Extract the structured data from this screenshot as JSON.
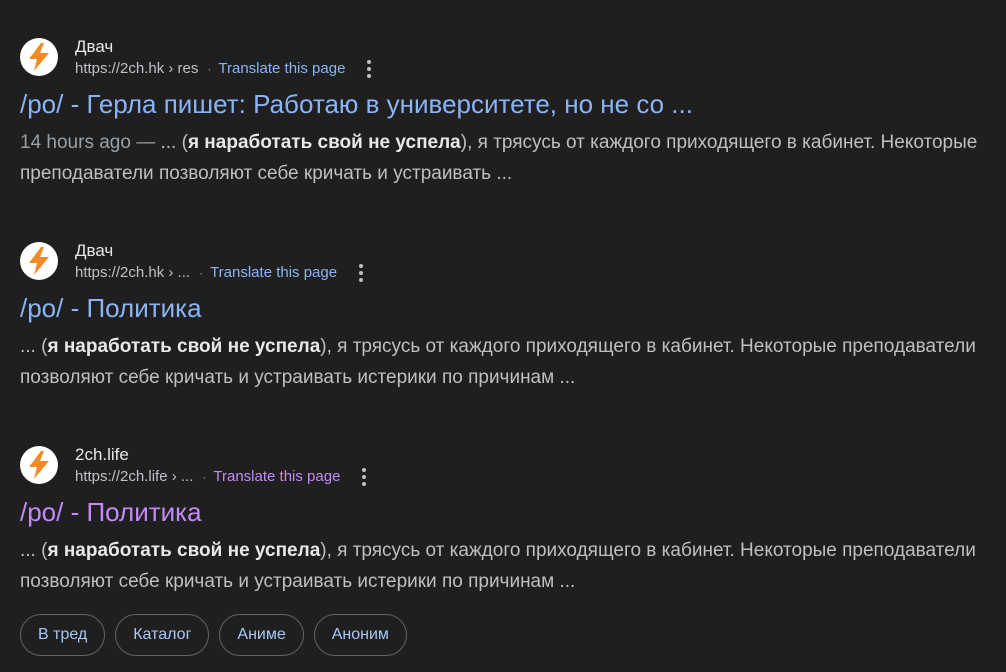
{
  "results": [
    {
      "site_name": "Двач",
      "url": "https://2ch.hk › res",
      "translate": "Translate this page",
      "title": "/po/ - Герла пишет: Работаю в университете, но не со ...",
      "date": "14 hours ago —",
      "pre": " ... (",
      "bold": "я наработать свой не успела",
      "post": "), я трясусь от каждого приходящего в кабинет. Некоторые преподаватели позволяют себе кричать и устраивать ..."
    },
    {
      "site_name": "Двач",
      "url": "https://2ch.hk › ...",
      "translate": "Translate this page",
      "title": "/po/ - Политика",
      "pre": "... (",
      "bold": "я наработать свой не успела",
      "post": "), я трясусь от каждого приходящего в кабинет. Некоторые преподаватели позволяют себе кричать и устраивать истерики по причинам ..."
    },
    {
      "site_name": "2ch.life",
      "url": "https://2ch.life › ...",
      "translate": "Translate this page",
      "title": "/po/ - Политика",
      "pre": "... (",
      "bold": "я наработать свой не успела",
      "post": "), я трясусь от каждого приходящего в кабинет. Некоторые преподаватели позволяют себе кричать и устраивать истерики по причинам ..."
    }
  ],
  "chips": [
    "В тред",
    "Каталог",
    "Аниме",
    "Аноним"
  ],
  "colors": {
    "background": "#1f1f1f",
    "link": "#8ab4f8",
    "visited_link": "#c58af9",
    "favicon_bolt": "#f08a24"
  },
  "icons": {
    "favicon": "lightning-bolt-icon",
    "more": "three-dots-vertical-icon"
  }
}
